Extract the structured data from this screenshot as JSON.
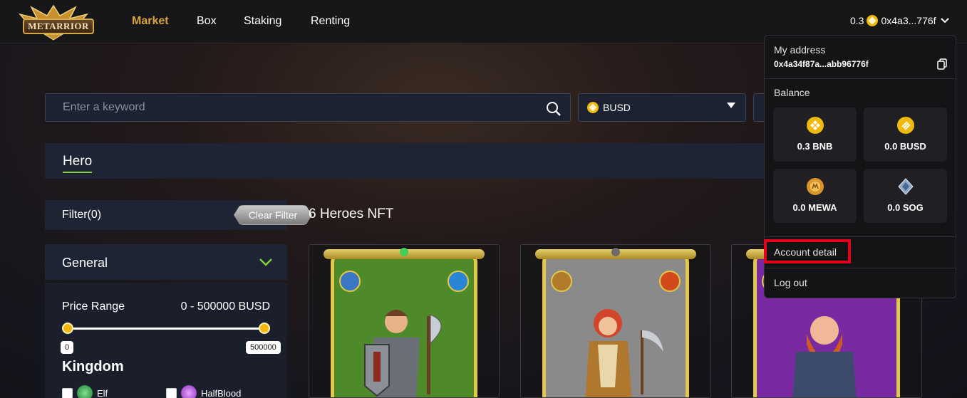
{
  "brand": {
    "logo_text": "METARRIOR"
  },
  "nav": {
    "items": [
      {
        "label": "Market",
        "active": true
      },
      {
        "label": "Box",
        "active": false
      },
      {
        "label": "Staking",
        "active": false
      },
      {
        "label": "Renting",
        "active": false
      }
    ]
  },
  "wallet": {
    "balance": "0.3",
    "address_short": "0x4a3...776f",
    "coin_icon": "bnb-coin-icon"
  },
  "search": {
    "placeholder": "Enter a keyword",
    "value": ""
  },
  "currency_select": {
    "selected": "BUSD"
  },
  "tabs": {
    "hero": "Hero"
  },
  "filter": {
    "title": "Filter(0)",
    "clear_label": "Clear Filter",
    "general_title": "General",
    "price_range_label": "Price Range",
    "price_range_value": "0 - 500000 BUSD",
    "min_tag": "0",
    "max_tag": "500000",
    "kingdom_title": "Kingdom",
    "kingdoms": [
      {
        "label": "Elf",
        "checked": false
      },
      {
        "label": "HalfBlood",
        "checked": false
      }
    ]
  },
  "heroes": {
    "count_label": "6 Heroes NFT",
    "cards": [
      {
        "background": "#4f8a2a",
        "left_icon_color": "#3a78c4",
        "right_icon_color": "#2a86d4"
      },
      {
        "background": "#8a8a8a",
        "left_icon_color": "#b07a2a",
        "right_icon_color": "#d24a1c"
      },
      {
        "background": "#7a2aa0",
        "left_icon_color": "#5a5a8a",
        "right_icon_color": "#5a5a8a"
      }
    ]
  },
  "account": {
    "my_address_label": "My address",
    "address_full": "0x4a34f87a...abb96776f",
    "balance_label": "Balance",
    "balances": [
      {
        "amount": "0.3 BNB",
        "icon": "bnb-icon"
      },
      {
        "amount": "0.0 BUSD",
        "icon": "busd-icon"
      },
      {
        "amount": "0.0 MEWA",
        "icon": "mewa-icon"
      },
      {
        "amount": "0.0 SOG",
        "icon": "sog-icon"
      }
    ],
    "account_detail_label": "Account detail",
    "logout_label": "Log out"
  },
  "colors": {
    "accent": "#d9a441",
    "tab_underline": "#7fd13b",
    "highlight": "#e5001c"
  }
}
